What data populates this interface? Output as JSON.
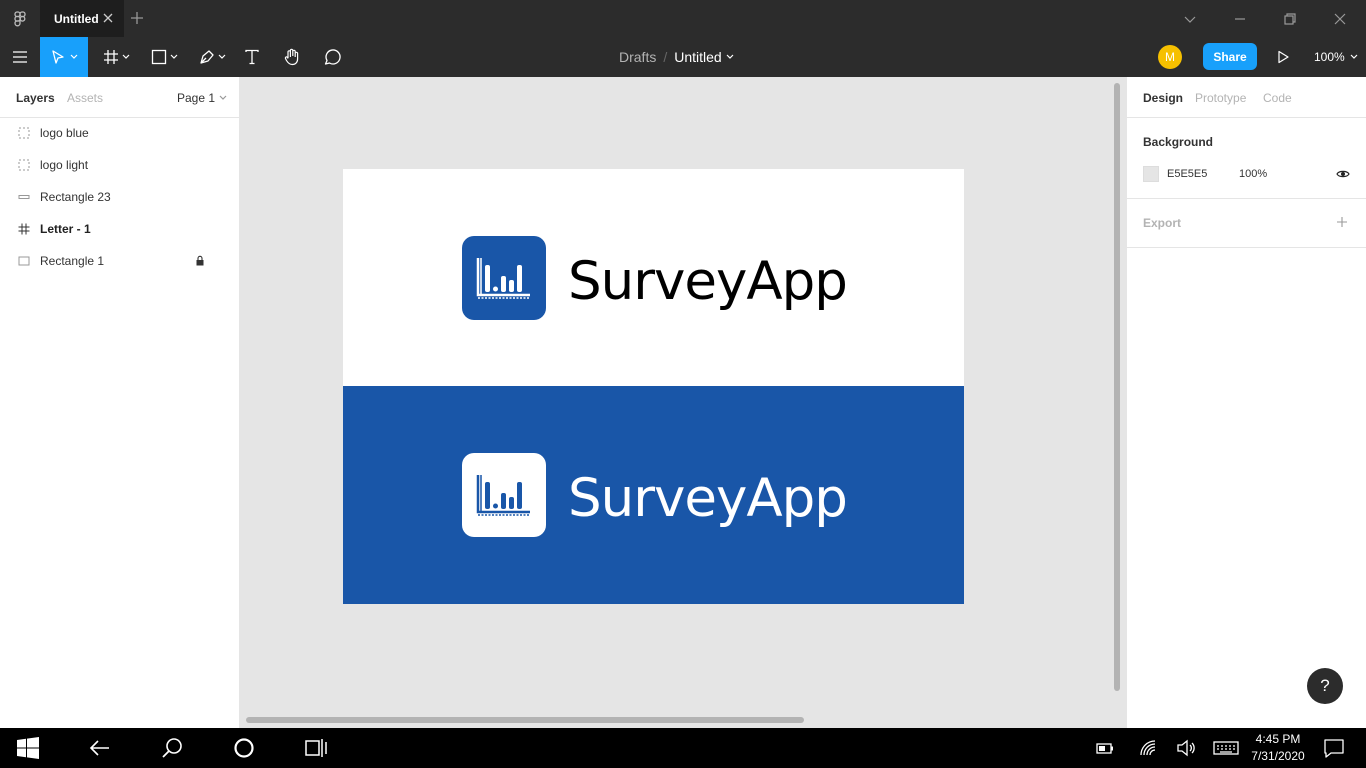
{
  "titlebar": {
    "tab_title": "Untitled",
    "icons": [
      "figma-logo-icon",
      "close-icon",
      "plus-icon",
      "chevron-down-icon",
      "minimize-icon",
      "restore-icon",
      "close-window-icon"
    ]
  },
  "toolbar": {
    "breadcrumb_drafts": "Drafts",
    "breadcrumb_sep": "/",
    "file_name": "Untitled",
    "avatar_initial": "M",
    "share_label": "Share",
    "zoom": "100%",
    "accent_color": "#18a0fb"
  },
  "left_panel": {
    "tab_layers": "Layers",
    "tab_assets": "Assets",
    "page_selector": "Page 1",
    "layers": [
      {
        "name": "logo blue",
        "icon": "component-dashed-icon"
      },
      {
        "name": "logo light",
        "icon": "component-dashed-icon"
      },
      {
        "name": "Rectangle 23",
        "icon": "rectangle-icon"
      },
      {
        "name": "Letter - 1",
        "icon": "frame-icon",
        "bold": true
      },
      {
        "name": "Rectangle 1",
        "icon": "rectangle-icon",
        "locked": true
      }
    ]
  },
  "canvas": {
    "background": "#e5e5e5",
    "brand_blue": "#1956a8",
    "logo_top_text": "SurveyApp",
    "logo_bottom_text": "SurveyApp"
  },
  "right_panel": {
    "tab_design": "Design",
    "tab_prototype": "Prototype",
    "tab_code": "Code",
    "background_label": "Background",
    "bg_hex": "E5E5E5",
    "bg_opacity": "100%",
    "export_label": "Export",
    "help_label": "?"
  },
  "taskbar": {
    "time": "4:45 PM",
    "date": "7/31/2020"
  }
}
